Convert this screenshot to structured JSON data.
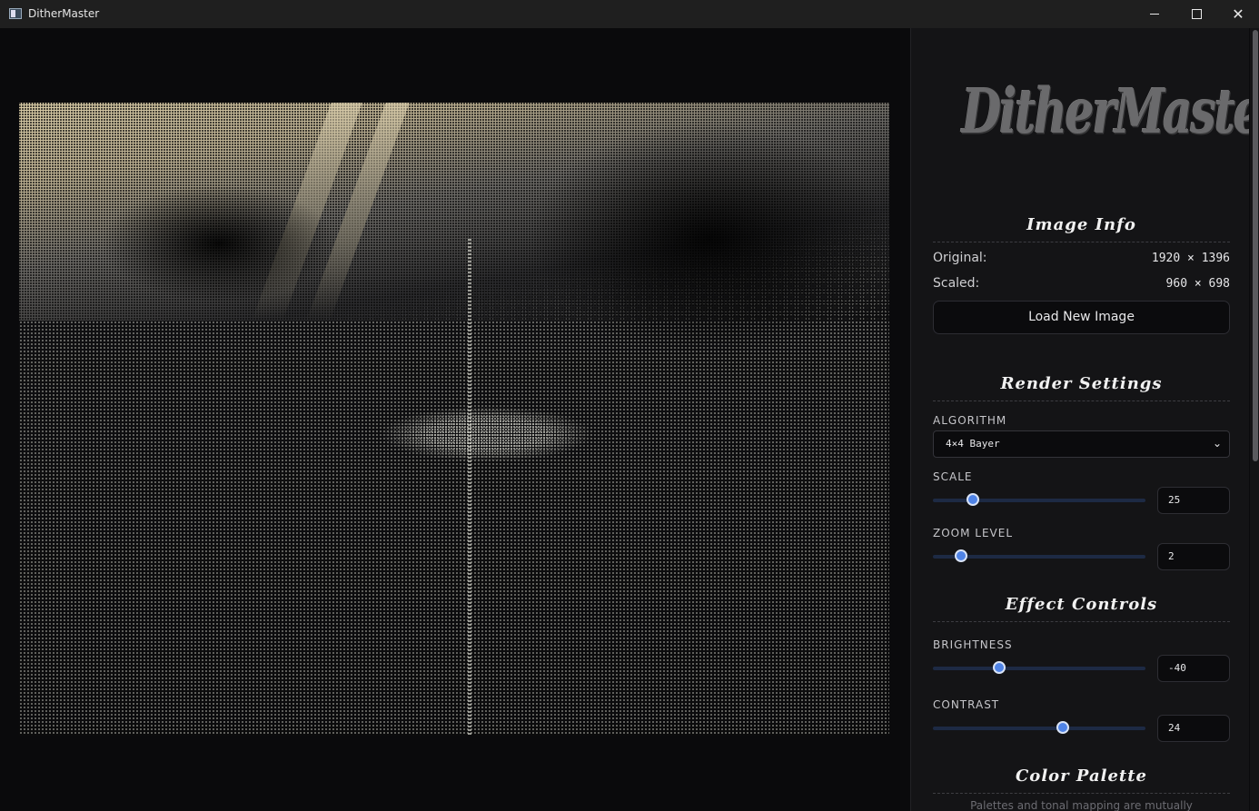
{
  "window": {
    "title": "DitherMaster",
    "minimize_icon": "minimize-icon",
    "maximize_icon": "maximize-icon",
    "close_label": "✕"
  },
  "logo": {
    "text": "DitherMaster"
  },
  "image_info": {
    "title": "Image Info",
    "original_label": "Original:",
    "original_value": "1920 × 1396",
    "scaled_label": "Scaled:",
    "scaled_value": "960 × 698",
    "load_button": "Load New Image"
  },
  "render_settings": {
    "title": "Render Settings",
    "algorithm_label": "ALGORITHM",
    "algorithm_value": "4×4 Bayer",
    "scale_label": "SCALE",
    "scale_value": "25",
    "zoom_label": "ZOOM LEVEL",
    "zoom_value": "2"
  },
  "effect_controls": {
    "title": "Effect Controls",
    "brightness_label": "BRIGHTNESS",
    "brightness_value": "-40",
    "contrast_label": "CONTRAST",
    "contrast_value": "24"
  },
  "color_palette": {
    "title": "Color Palette",
    "hint": "Palettes and tonal mapping are mutually"
  },
  "colors": {
    "accent": "#4f83e6",
    "panel_bg": "#141416",
    "canvas_bg": "#0a0a0c"
  }
}
